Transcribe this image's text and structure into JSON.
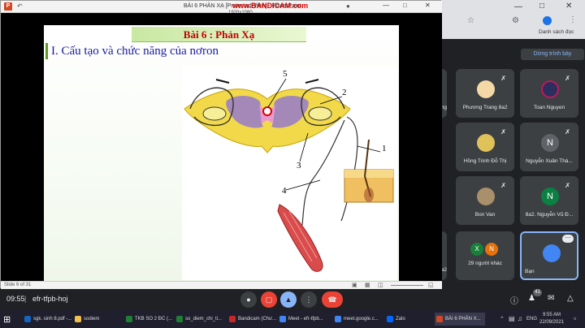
{
  "ppt": {
    "title": "BÀI 6  PHẢN XẠ [Protected View] - PowerPoint",
    "bandicam": "www.BANDICAM.com",
    "resolution": "1920x1080",
    "slide_indicator": "Slide 6 of 31"
  },
  "browser": {
    "bookmark": "Danh sách đọc"
  },
  "slide": {
    "banner": "Bài 6 : Phản Xạ",
    "heading": "I. Cấu tạo và chức năng của nơron"
  },
  "figure_labels": [
    "5",
    "2",
    "1",
    "3",
    "4"
  ],
  "meet": {
    "present_button": "Dừng trình bày",
    "tiles": [
      {
        "name": "Phương Trang 8a2",
        "initial": "",
        "color": "#f4d9a6"
      },
      {
        "name": "Toan Nguyen",
        "initial": "",
        "color": "#2b2f5e"
      },
      {
        "name": "Hồng Trinh Đỗ Thị",
        "initial": "",
        "color": "#e0c25a"
      },
      {
        "name": "Nguyễn Xuân Thà...",
        "initial": "N",
        "color": "#5f6368"
      },
      {
        "name": "Bon Van",
        "initial": "",
        "color": "#a98f6a"
      },
      {
        "name": "8a2. Nguyễn Vũ Đ...",
        "initial": "N",
        "color": "#0b8043"
      },
      {
        "name": "29 người khác",
        "initial": "",
        "color": "#3c4043"
      },
      {
        "name": "Bạn",
        "initial": "",
        "color": "#4285f4"
      }
    ],
    "others": [
      "X",
      "N"
    ],
    "partial_labels": [
      "ng",
      "3a2",
      "3a2"
    ],
    "time": "09:55",
    "meeting_code": "efr-tfpb-hoj",
    "participant_count": "41"
  },
  "taskbar": {
    "items": [
      {
        "label": "sgk. sinh 8.pdf -...",
        "color": "#1565c0"
      },
      {
        "label": "sodiem",
        "color": "#f2c14e"
      },
      {
        "label": "TKB SO 2 ĐC (...",
        "color": "#1e7e34"
      },
      {
        "label": "so_diem_chi_ti...",
        "color": "#1e7e34"
      },
      {
        "label": "Bandicam (Chư...",
        "color": "#c62828"
      },
      {
        "label": "Meet - efr-tfpb...",
        "color": "#4285f4"
      },
      {
        "label": "meet.google.c...",
        "color": "#4285f4"
      },
      {
        "label": "Zalo",
        "color": "#0068ff"
      },
      {
        "label": "BÀI 6  PHẢN X...",
        "color": "#d24726"
      }
    ],
    "lang": "ENG",
    "clock_time": "9:55 AM",
    "clock_date": "22/09/2021"
  }
}
